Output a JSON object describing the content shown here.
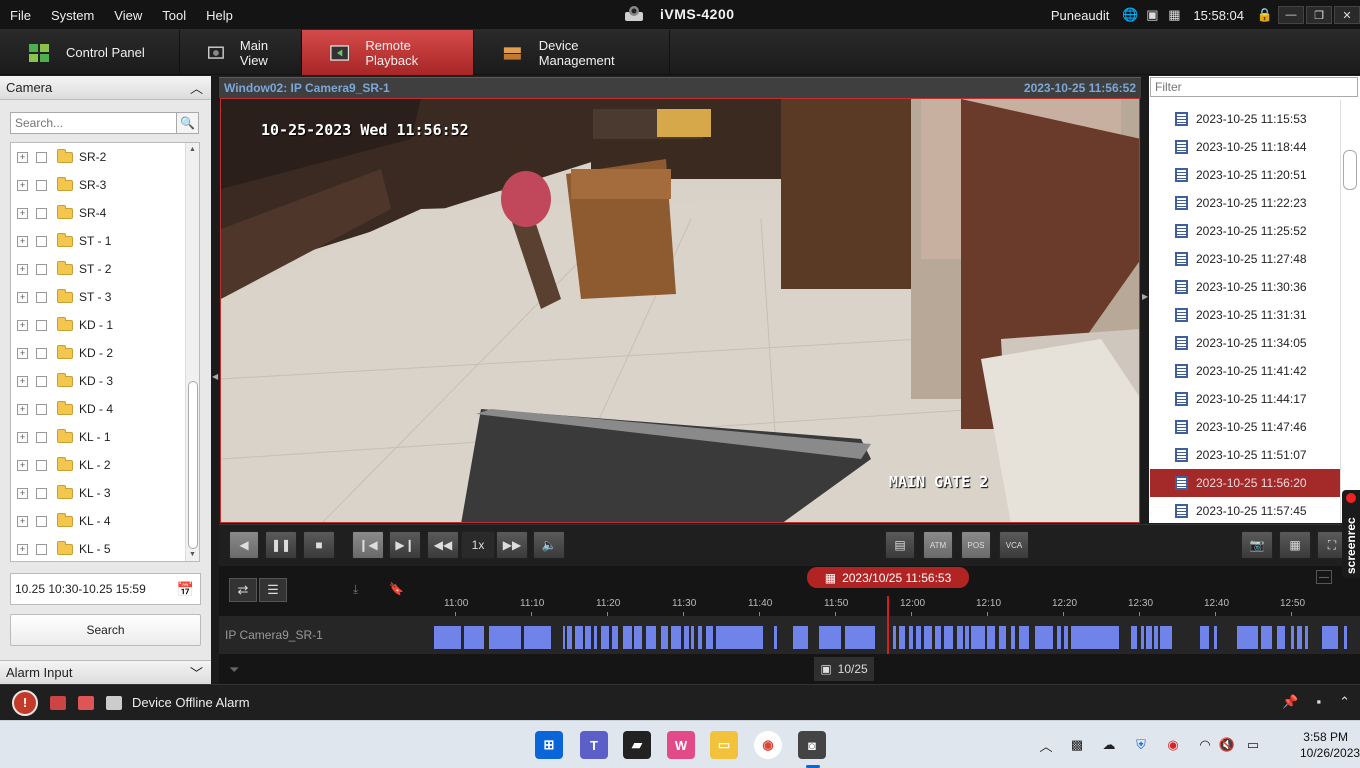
{
  "menu": {
    "items": [
      "File",
      "System",
      "View",
      "Tool",
      "Help"
    ]
  },
  "app": {
    "title": "iVMS-4200",
    "user": "Puneaudit",
    "clock": "15:58:04"
  },
  "tabs": [
    {
      "label": "Control Panel",
      "icon": "control-panel-icon"
    },
    {
      "label": "Main View",
      "icon": "main-view-icon"
    },
    {
      "label": "Remote Playback",
      "icon": "remote-playback-icon",
      "active": true
    },
    {
      "label": "Device Management",
      "icon": "device-management-icon"
    }
  ],
  "left": {
    "header": "Camera",
    "search_placeholder": "Search...",
    "tree": [
      "SR-2",
      "SR-3",
      "SR-4",
      "ST - 1",
      "ST - 2",
      "ST - 3",
      "KD - 1",
      "KD - 2",
      "KD - 3",
      "KD - 4",
      "KL - 1",
      "KL - 2",
      "KL - 3",
      "KL - 4",
      "KL - 5"
    ],
    "time_range": "10.25 10:30-10.25 15:59",
    "search_button": "Search",
    "alarm_header": "Alarm Input"
  },
  "video": {
    "window_label": "Window02:  IP Camera9_SR-1",
    "timestamp": "2023-10-25 11:56:52",
    "osd_time": "10-25-2023 Wed 11:56:52",
    "osd_name": "MAIN GATE 2"
  },
  "files": {
    "filter_placeholder": "Filter",
    "items": [
      "2023-10-25 11:15:53",
      "2023-10-25 11:18:44",
      "2023-10-25 11:20:51",
      "2023-10-25 11:22:23",
      "2023-10-25 11:25:52",
      "2023-10-25 11:27:48",
      "2023-10-25 11:30:36",
      "2023-10-25 11:31:31",
      "2023-10-25 11:34:05",
      "2023-10-25 11:41:42",
      "2023-10-25 11:44:17",
      "2023-10-25 11:47:46",
      "2023-10-25 11:51:07",
      "2023-10-25 11:56:20",
      "2023-10-25 11:57:45"
    ],
    "selected": "2023-10-25 11:56:20"
  },
  "controls": {
    "speed": "1x",
    "atm": "ATM",
    "pos": "POS",
    "vca": "VCA"
  },
  "timeline": {
    "date": "2023/10/25 11:56:53",
    "ticks": [
      "11:00",
      "11:10",
      "11:20",
      "11:30",
      "11:40",
      "11:50",
      "12:00",
      "12:10",
      "12:20",
      "12:30",
      "12:40",
      "12:50"
    ],
    "camera": "IP Camera9_SR-1",
    "day": "10/25"
  },
  "alarm": {
    "text": "Device Offline Alarm"
  },
  "taskbar": {
    "time": "3:58 PM",
    "date": "10/26/2023"
  },
  "screenrec": {
    "label": "screenrec"
  }
}
